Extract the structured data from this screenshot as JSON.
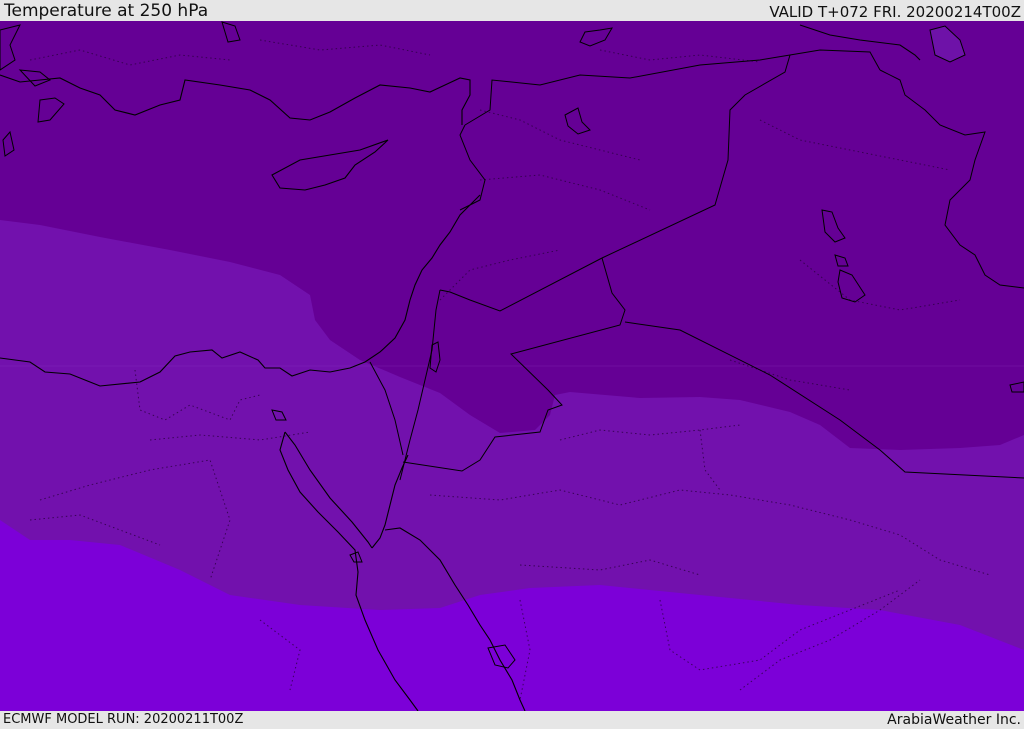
{
  "header": {
    "title": "Temperature at 250 hPa",
    "valid_time": "VALID T+072 FRI. 20200214T00Z"
  },
  "footer": {
    "model_run": "ECMWF MODEL RUN: 20200211T00Z",
    "brand": "ArabiaWeather Inc."
  },
  "colors": {
    "band_cold": "#650095",
    "band_mid": "#7211ad",
    "band_warm": "#7c00d8",
    "coastline": "#000000",
    "lake": "#6e12a8"
  }
}
